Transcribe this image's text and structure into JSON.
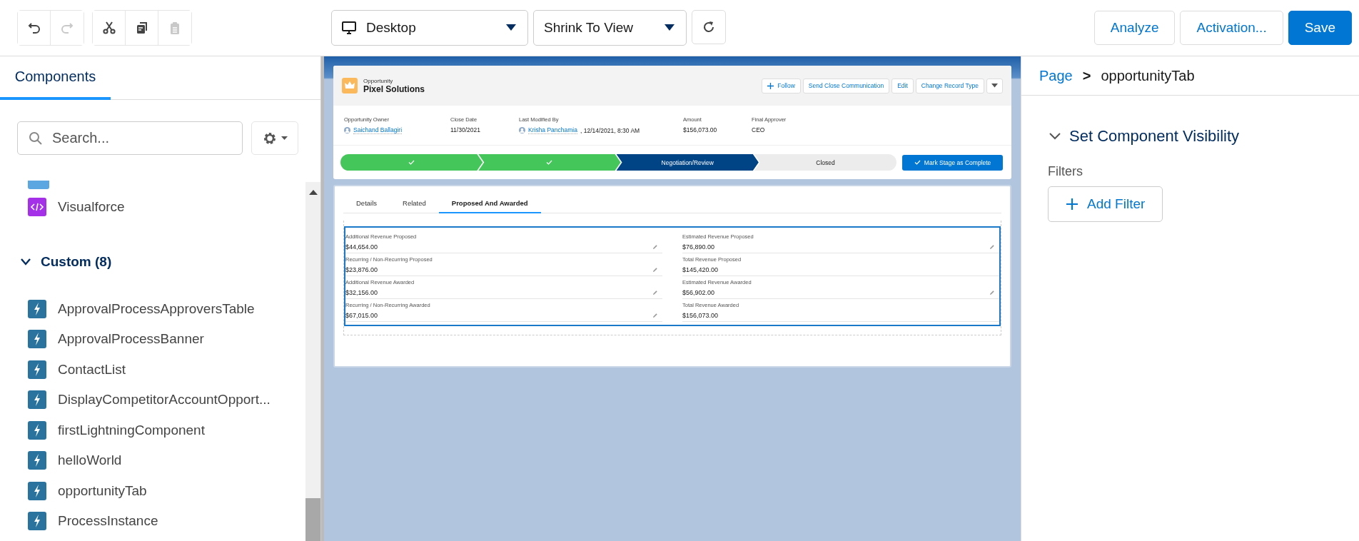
{
  "toolbar": {
    "history": [
      {
        "kind": "undo",
        "disabled": false
      },
      {
        "kind": "redo",
        "disabled": true
      }
    ],
    "clipboard": [
      {
        "kind": "cut",
        "disabled": false
      },
      {
        "kind": "copy",
        "disabled": false
      },
      {
        "kind": "paste",
        "disabled": true
      }
    ],
    "device": "Desktop",
    "zoom": "Shrink To View",
    "actions": [
      {
        "label": "Analyze",
        "kind": "neutral"
      },
      {
        "label": "Activation...",
        "kind": "neutral"
      },
      {
        "label": "Save",
        "kind": "brand"
      }
    ]
  },
  "left_panel": {
    "tabs": [
      {
        "label": "Components",
        "selected": true
      }
    ],
    "search": {
      "placeholder": "Search..."
    },
    "standard_items": [
      {
        "label": "Visualforce",
        "kind": "visualforce"
      }
    ],
    "custom_group": {
      "label": "Custom (8)",
      "expanded": true,
      "items": [
        "ApprovalProcessApproversTable",
        "ApprovalProcessBanner",
        "ContactList",
        "DisplayCompetitorAccountOpport...",
        "firstLightningComponent",
        "helloWorld",
        "opportunityTab",
        "ProcessInstance"
      ]
    }
  },
  "canvas": {
    "record": {
      "object": "Opportunity",
      "name": "Pixel Solutions",
      "actions": [
        {
          "label": "Follow",
          "kind": "follow"
        },
        {
          "label": "Send Close Communication",
          "kind": "plain"
        },
        {
          "label": "Edit",
          "kind": "plain"
        },
        {
          "label": "Change Record Type",
          "kind": "plain"
        }
      ],
      "highlights": [
        {
          "label": "Opportunity Owner",
          "kind": "user",
          "value": "Saichand Ballagiri"
        },
        {
          "label": "Close Date",
          "kind": "text",
          "value": "11/30/2021"
        },
        {
          "label": "Last Modified By",
          "kind": "user",
          "value": "Krisha Panchamia",
          "suffix": ", 12/14/2021, 8:30 AM"
        },
        {
          "label": "Amount",
          "kind": "text",
          "value": "$156,073.00"
        },
        {
          "label": "Final Approver",
          "kind": "text",
          "value": "CEO"
        }
      ],
      "path": [
        {
          "kind": "complete"
        },
        {
          "kind": "complete"
        },
        {
          "kind": "current",
          "label": "Negotiation/Review"
        },
        {
          "kind": "incomplete",
          "label": "Closed"
        }
      ],
      "mark_button": "Mark Stage as Complete"
    },
    "tabs": [
      {
        "label": "Details",
        "selected": false
      },
      {
        "label": "Related",
        "selected": false
      },
      {
        "label": "Proposed And Awarded",
        "selected": true
      }
    ],
    "fields": [
      {
        "label": "Additional Revenue Proposed",
        "value": "$44,654.00",
        "editable": true
      },
      {
        "label": "Estimated Revenue Proposed",
        "value": "$76,890.00",
        "editable": true
      },
      {
        "label": "Recurring / Non-Recurring Proposed",
        "value": "$23,876.00",
        "editable": true
      },
      {
        "label": "Total Revenue Proposed",
        "value": "$145,420.00",
        "editable": false
      },
      {
        "label": "Additional Revenue Awarded",
        "value": "$32,156.00",
        "editable": true
      },
      {
        "label": "Estimated Revenue Awarded",
        "value": "$56,902.00",
        "editable": true
      },
      {
        "label": "Recurring / Non-Recurring Awarded",
        "value": "$67,015.00",
        "editable": true
      },
      {
        "label": "Total Revenue Awarded",
        "value": "$156,073.00",
        "editable": false
      }
    ]
  },
  "right_panel": {
    "breadcrumb": [
      "Page",
      "opportunityTab"
    ],
    "separator": ">",
    "section": {
      "label": "Set Component Visibility",
      "expanded": true
    },
    "filters_label": "Filters",
    "add_filter": "Add Filter"
  }
}
